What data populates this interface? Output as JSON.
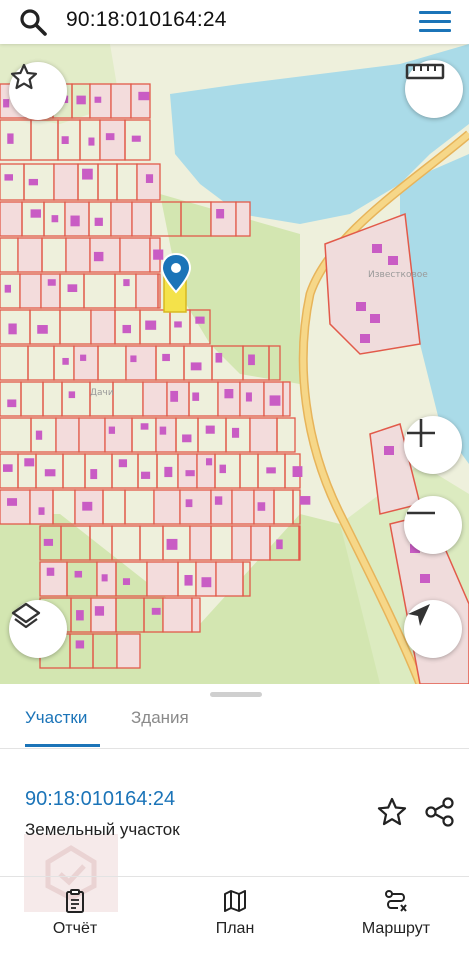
{
  "search": {
    "query": "90:18:010164:24"
  },
  "map": {
    "labels": {
      "settlement": "Известковое",
      "dachi": "Дачи"
    },
    "colors": {
      "water": "#aadbe8",
      "land": "#eef0dc",
      "greenery": "#d3e6b1",
      "parcel_border": "#e25a4a",
      "building": "#c95cc4",
      "selected_parcel": "#f4e24a",
      "marker": "#1b74b8",
      "road": "#f6d788"
    }
  },
  "sheet": {
    "tabs": [
      "Участки",
      "Здания"
    ],
    "active_tab": "Участки",
    "parcel": {
      "number": "90:18:010164:24",
      "type": "Земельный участок"
    }
  },
  "bottom_nav": [
    {
      "label": "Отчёт",
      "icon": "report-icon"
    },
    {
      "label": "План",
      "icon": "map-icon"
    },
    {
      "label": "Маршрут",
      "icon": "route-icon"
    }
  ]
}
